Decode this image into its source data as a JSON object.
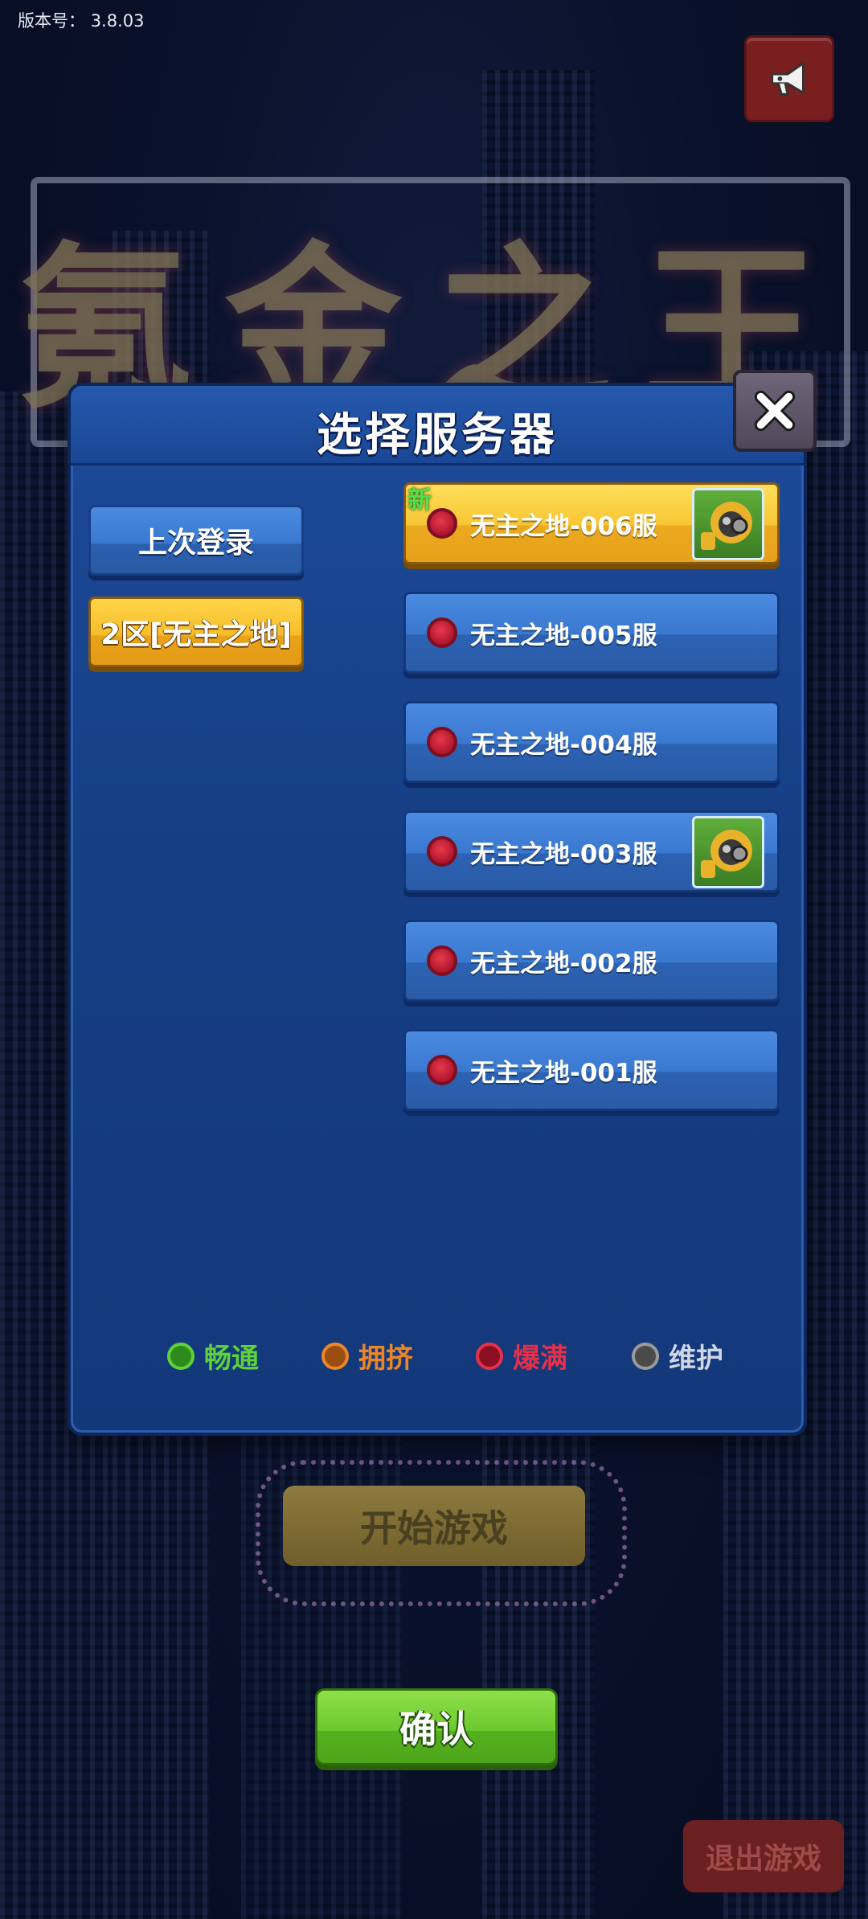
{
  "version": {
    "label": "版本号：",
    "value": "3.8.03"
  },
  "background": {
    "logo_text": "氪金之王",
    "start_game_label": "开始游戏",
    "quit_game_label": "退出游戏"
  },
  "dialog": {
    "title": "选择服务器",
    "close_icon": "close-icon",
    "tabs": [
      {
        "label": "上次登录",
        "selected": false
      },
      {
        "label": "2区[无主之地]",
        "selected": true
      }
    ],
    "servers": [
      {
        "name": "无主之地-006服",
        "status": "爆满",
        "selected": true,
        "is_new": true,
        "new_label": "新",
        "has_avatar": true
      },
      {
        "name": "无主之地-005服",
        "status": "爆满",
        "selected": false,
        "is_new": false,
        "has_avatar": false
      },
      {
        "name": "无主之地-004服",
        "status": "爆满",
        "selected": false,
        "is_new": false,
        "has_avatar": false
      },
      {
        "name": "无主之地-003服",
        "status": "爆满",
        "selected": false,
        "is_new": false,
        "has_avatar": true
      },
      {
        "name": "无主之地-002服",
        "status": "爆满",
        "selected": false,
        "is_new": false,
        "has_avatar": false
      },
      {
        "name": "无主之地-001服",
        "status": "爆满",
        "selected": false,
        "is_new": false,
        "has_avatar": false
      }
    ],
    "legend": [
      {
        "label": "畅通",
        "color": "#5fd13a"
      },
      {
        "label": "拥挤",
        "color": "#e9862a"
      },
      {
        "label": "爆满",
        "color": "#e5304a"
      },
      {
        "label": "维护",
        "color": "#9a9a9a"
      }
    ]
  },
  "confirm_label": "确认",
  "colors": {
    "status_full": "#e5304a",
    "selected_server": "#f7c635",
    "confirm": "#6cc92e"
  }
}
